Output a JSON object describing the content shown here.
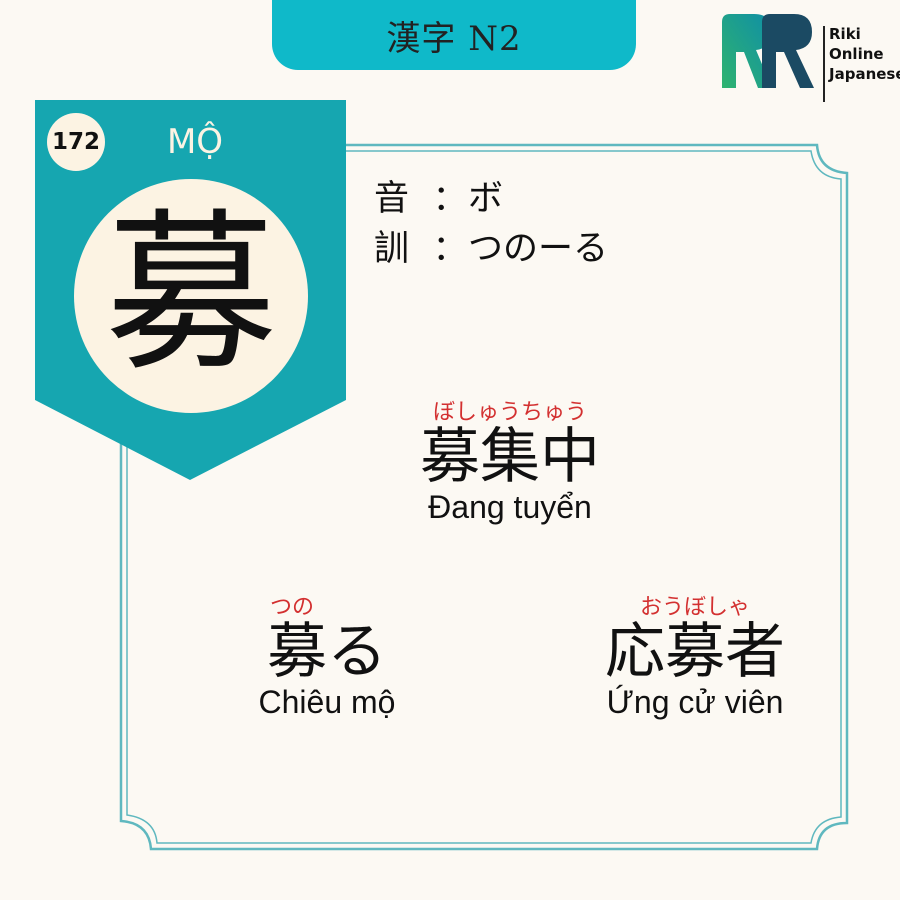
{
  "header": {
    "title": "漢字 N2"
  },
  "logo": {
    "line1": "Riki",
    "line2": "Online",
    "line3": "Japanese"
  },
  "card": {
    "number": "172",
    "vietnamese_reading": "MỘ",
    "kanji": "募",
    "on_label": "音",
    "on_value": "ボ",
    "kun_label": "訓",
    "kun_value": "つのーる",
    "separator": "："
  },
  "vocabulary": [
    {
      "furigana": "ぼしゅうちゅう",
      "word": "募集中",
      "meaning": "Đang tuyển"
    },
    {
      "furigana": "つの",
      "word": "募る",
      "meaning": "Chiêu mộ"
    },
    {
      "furigana": "おうぼしゃ",
      "word": "応募者",
      "meaning": "Ứng cử viên"
    }
  ],
  "colors": {
    "teal": "#0fb9c9",
    "banner": "#16a6b0",
    "cream": "#fcf3e3",
    "furigana": "#d33030",
    "frame": "#5fb8bf"
  }
}
